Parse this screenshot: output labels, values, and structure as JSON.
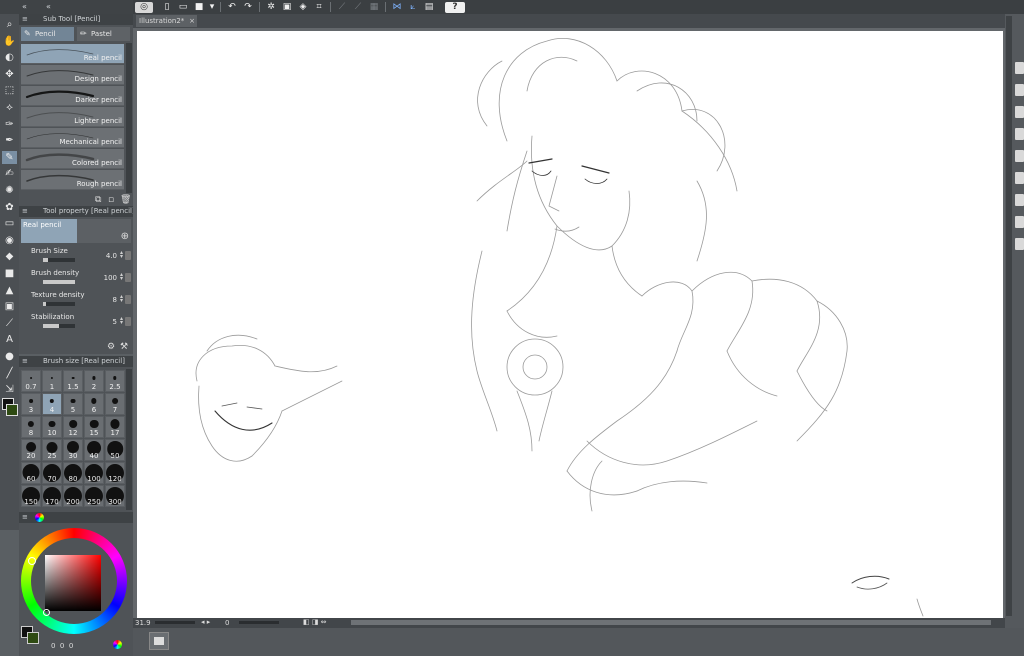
{
  "top_toolbar": {
    "icons": [
      "app-icon",
      "new-file-icon",
      "open-file-icon",
      "save-icon",
      "undo-icon",
      "redo-icon",
      "clear-icon",
      "fill-icon",
      "transform-icon",
      "snap-icon",
      "ruler-icon",
      "help-icon"
    ],
    "help_label": "?"
  },
  "tools": [
    "zoom-icon",
    "hand-icon",
    "rotate-icon",
    "move-icon",
    "select-icon",
    "lasso-icon",
    "eyedropper-icon",
    "pen-icon",
    "pencil-icon",
    "brush-icon",
    "airbrush-icon",
    "decoration-icon",
    "eraser-icon",
    "blend-icon",
    "fill-icon",
    "gradient-icon",
    "figure-icon",
    "frame-icon",
    "ruler-icon",
    "text-icon",
    "balloon-icon",
    "line-icon",
    "correct-icon"
  ],
  "sub_tool": {
    "title": "Sub Tool [Pencil]",
    "tabs": [
      {
        "label": "Pencil",
        "icon": "pencil-icon",
        "active": true
      },
      {
        "label": "Pastel",
        "icon": "pastel-icon",
        "active": false
      }
    ],
    "brushes": [
      {
        "label": "Real pencil",
        "selected": true
      },
      {
        "label": "Design pencil",
        "selected": false
      },
      {
        "label": "Darker pencil",
        "selected": false
      },
      {
        "label": "Lighter pencil",
        "selected": false
      },
      {
        "label": "Mechanical pencil",
        "selected": false
      },
      {
        "label": "Colored pencil",
        "selected": false
      },
      {
        "label": "Rough pencil",
        "selected": false
      }
    ]
  },
  "tool_property": {
    "title": "Tool property [Real pencil]",
    "preset_name": "Real pencil",
    "properties": [
      {
        "label": "Brush Size",
        "value": "4.0",
        "fill": 0.15
      },
      {
        "label": "Brush density",
        "value": "100",
        "fill": 1.0
      },
      {
        "label": "Texture density",
        "value": "8",
        "fill": 0.08
      },
      {
        "label": "Stabilization",
        "value": "5",
        "fill": 0.5
      }
    ]
  },
  "brush_size": {
    "title": "Brush size [Real pencil]",
    "sizes": [
      "0.7",
      "1",
      "1.5",
      "2",
      "2.5",
      "3",
      "4",
      "5",
      "6",
      "7",
      "8",
      "10",
      "12",
      "15",
      "17",
      "20",
      "25",
      "30",
      "40",
      "50",
      "60",
      "70",
      "80",
      "100",
      "120",
      "150",
      "170",
      "200",
      "250",
      "300"
    ],
    "selected": "4"
  },
  "color": {
    "main": "#111111",
    "sub": "#2e4a12",
    "readout": [
      "0",
      "0",
      "0"
    ]
  },
  "document": {
    "tab_label": "Illustration2*"
  },
  "status": {
    "zoom": "31.9",
    "angle": "0"
  }
}
